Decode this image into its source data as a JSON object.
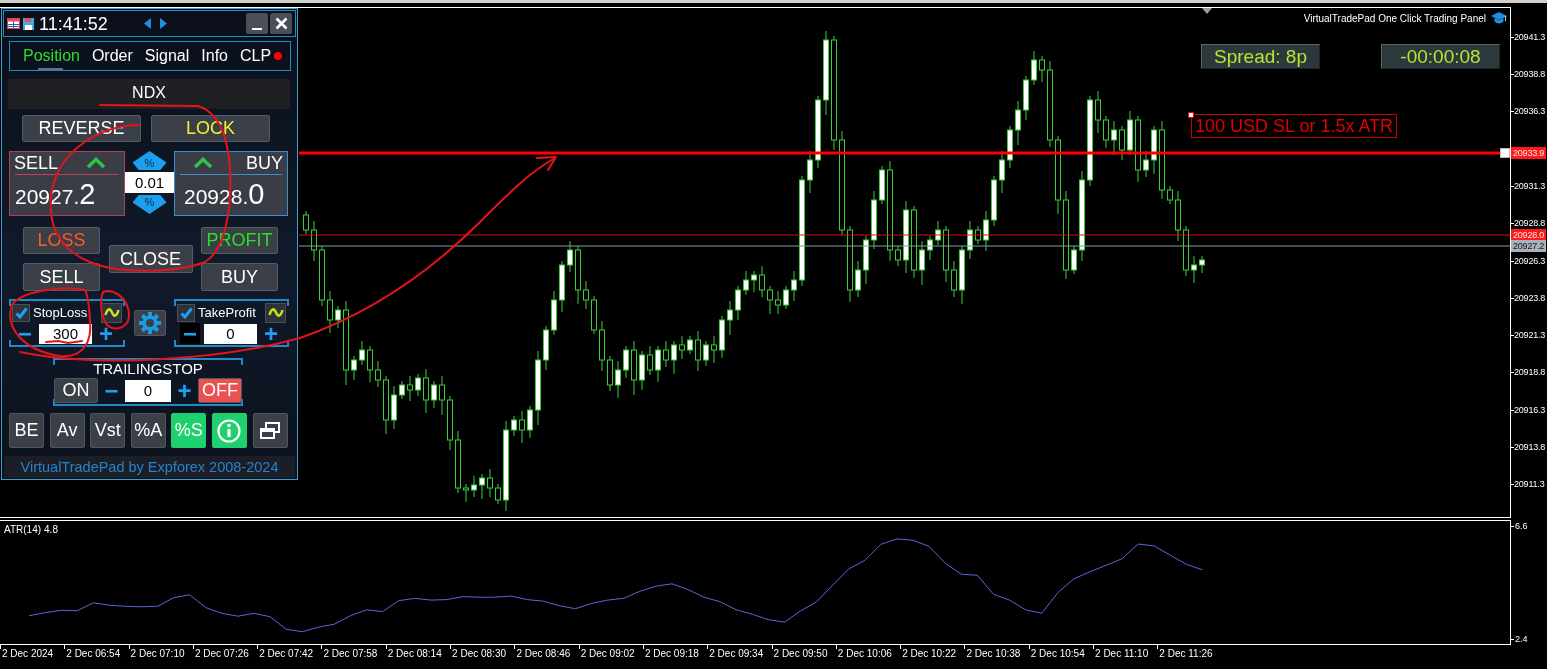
{
  "panel": {
    "time": "11:41:52",
    "tabs": [
      {
        "label": "Position",
        "selected": true
      },
      {
        "label": "Order",
        "selected": false
      },
      {
        "label": "Signal",
        "selected": false
      },
      {
        "label": "Info",
        "selected": false
      },
      {
        "label": "CLP",
        "selected": false,
        "color": "#ff0000"
      }
    ],
    "symbol": "NDX",
    "actions": [
      {
        "kind": "reverse",
        "label": "REVERSE"
      },
      {
        "kind": "lock",
        "label": "LOCK"
      }
    ],
    "sell_quote": {
      "label": "SELL",
      "price": "20927.2"
    },
    "lot": {
      "up": "%",
      "value": "0.01",
      "down": "%"
    },
    "buy_quote": {
      "label": "BUY",
      "price": "20928.0"
    },
    "orders": [
      {
        "kind": "loss",
        "label": "LOSS"
      },
      {
        "kind": "close",
        "label": "CLOSE"
      },
      {
        "kind": "profit",
        "label": "PROFIT"
      },
      {
        "kind": "sell",
        "label": "SELL"
      },
      {
        "kind": "buy",
        "label": "BUY"
      }
    ],
    "stop_loss": {
      "checked": true,
      "label": "StopLoss",
      "minus": "−",
      "value": "300",
      "plus": "+"
    },
    "take_profit": {
      "checked": true,
      "label": "TakeProfit",
      "minus": "−",
      "value": "0",
      "plus": "+"
    },
    "trailing_stop": {
      "label": "TRAILINGSTOP",
      "switches": [
        {
          "kind": "on",
          "label": "ON",
          "selected": false
        },
        {
          "kind": "off",
          "label": "OFF",
          "selected": true
        }
      ],
      "minus": "−",
      "value": "0",
      "plus": "+"
    },
    "tools": [
      {
        "kind": "text",
        "label": "BE",
        "on": false
      },
      {
        "kind": "text",
        "label": "Av",
        "on": false
      },
      {
        "kind": "text",
        "label": "Vst",
        "on": false
      },
      {
        "kind": "text",
        "label": "%A",
        "on": false
      },
      {
        "kind": "text",
        "label": "%S",
        "on": true
      },
      {
        "kind": "info",
        "on": true
      },
      {
        "kind": "window",
        "on": false
      }
    ],
    "footer": "VirtualTradePad by Expforex 2008-2024"
  },
  "chart": {
    "caption": "VirtualTradePad One Click Trading Panel",
    "spread": "Spread: 8p",
    "countdown": "-00:00:08",
    "note": "100 USD SL or 1.5x ATR",
    "price_axis": [
      "20941.3",
      "20938.8",
      "20936.3",
      "20931.3",
      "20928.8",
      "20926.3",
      "20923.8",
      "20921.3",
      "20918.8",
      "20916.3",
      "20913.8",
      "20911.3"
    ],
    "price_tags": [
      {
        "kind": "line",
        "label": "20933.9"
      },
      {
        "kind": "ask",
        "label": "20928.0"
      },
      {
        "kind": "bid",
        "label": "20927.2"
      }
    ]
  },
  "indicator": {
    "reading": "4.8",
    "chart_data": {
      "type": "line",
      "ylim": [
        2.2,
        6.8
      ],
      "yticks": [
        6.6,
        2.4
      ],
      "categories": [
        "2 Dec 2024",
        null,
        null,
        null,
        "2 Dec 06:54",
        null,
        null,
        null,
        "2 Dec 07:10",
        null,
        null,
        null,
        "2 Dec 07:26",
        null,
        null,
        null,
        "2 Dec 07:42",
        null,
        null,
        null,
        "2 Dec 07:58",
        null,
        null,
        null,
        "2 Dec 08:14",
        null,
        null,
        null,
        "2 Dec 08:30",
        null,
        null,
        null,
        "2 Dec 08:46",
        null,
        null,
        null,
        "2 Dec 09:02",
        null,
        null,
        null,
        "2 Dec 09:18",
        null,
        null,
        null,
        "2 Dec 09:34",
        null,
        null,
        null,
        "2 Dec 09:50",
        null,
        null,
        null,
        "2 Dec 10:06",
        null,
        null,
        null,
        "2 Dec 10:22",
        null,
        null,
        null,
        "2 Dec 10:38",
        null,
        null,
        null,
        "2 Dec 10:54",
        null,
        null,
        null,
        "2 Dec 11:10",
        null,
        null,
        null,
        "2 Dec 11:26",
        null,
        null,
        null,
        null,
        null,
        null,
        null,
        null,
        null,
        null,
        null,
        null,
        null,
        null,
        null,
        null,
        null,
        null,
        null,
        null,
        null
      ],
      "series": [
        {
          "name": "ATR(14)",
          "color": "#5a68d8",
          "values": [
            3.26,
            3.37,
            3.46,
            3.44,
            3.74,
            3.65,
            3.61,
            3.59,
            3.61,
            3.93,
            4.04,
            3.56,
            3.35,
            3.24,
            3.35,
            3.22,
            2.75,
            2.66,
            2.83,
            2.94,
            3.26,
            3.48,
            3.41,
            3.82,
            3.91,
            3.84,
            3.86,
            3.97,
            3.95,
            3.95,
            3.99,
            3.86,
            3.8,
            3.63,
            3.52,
            3.72,
            3.84,
            3.91,
            4.17,
            4.36,
            4.45,
            4.23,
            3.95,
            3.78,
            3.48,
            3.31,
            3.11,
            3.02,
            3.44,
            3.78,
            4.4,
            5.01,
            5.33,
            5.93,
            6.13,
            6.08,
            5.85,
            5.22,
            4.81,
            4.77,
            4.06,
            3.84,
            3.48,
            3.35,
            4.12,
            4.64,
            4.9,
            5.14,
            5.39,
            5.94,
            5.87,
            5.52,
            5.18,
            4.97,
            null,
            null,
            null,
            null,
            null,
            null,
            null,
            null,
            null,
            null,
            null,
            null,
            null,
            null,
            null,
            null,
            null,
            null,
            null,
            null
          ]
        }
      ]
    }
  }
}
